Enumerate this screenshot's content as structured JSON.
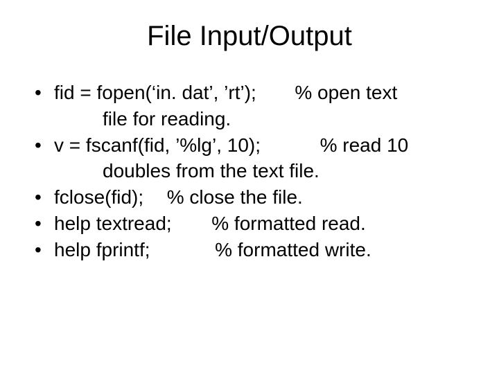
{
  "title": "File Input/Output",
  "bullets": [
    {
      "code": "fid = fopen(‘in. dat’, ’rt’);",
      "comment": "% open text",
      "cont": "file for reading."
    },
    {
      "code": "v = fscanf(fid, ’%lg’, 10);",
      "comment": "% read 10",
      "cont": "doubles from the text file."
    },
    {
      "code": "fclose(fid);",
      "comment": "% close the file.",
      "cont": ""
    },
    {
      "code": "help textread;",
      "comment": "% formatted read.",
      "cont": ""
    },
    {
      "code": "help fprintf;",
      "comment": "% formatted write.",
      "cont": ""
    }
  ]
}
